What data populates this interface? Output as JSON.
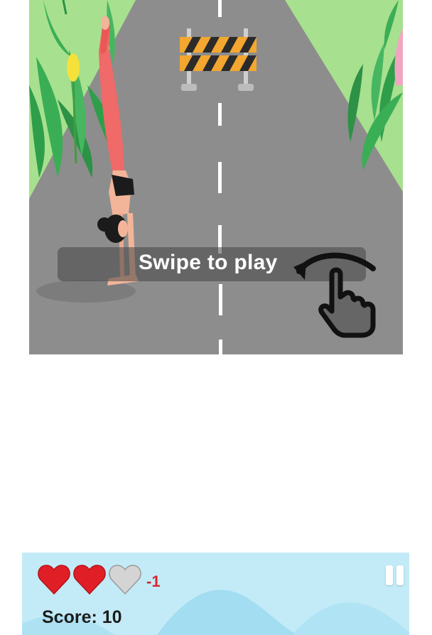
{
  "game": {
    "prompt_text": "Swipe to play",
    "gesture_icon": "swipe-hand-icon",
    "obstacle_icon": "road-barrier-icon",
    "character_icon": "handstand-yoga-woman-icon"
  },
  "hud": {
    "lives": [
      {
        "icon": "heart-full-icon",
        "state": "full",
        "color": "#e01e26"
      },
      {
        "icon": "heart-full-icon",
        "state": "full",
        "color": "#e01e26"
      },
      {
        "icon": "heart-empty-icon",
        "state": "lost",
        "color": "#d4d4d4"
      }
    ],
    "life_delta": "-1",
    "score_text": "Score: 10",
    "pause_icon": "pause-icon"
  },
  "colors": {
    "road": "#8d8d8d",
    "grass": "#a7e08e",
    "hud_bg": "#c0e9f6",
    "heart_red": "#e01e26",
    "delta_red": "#d9262b"
  }
}
